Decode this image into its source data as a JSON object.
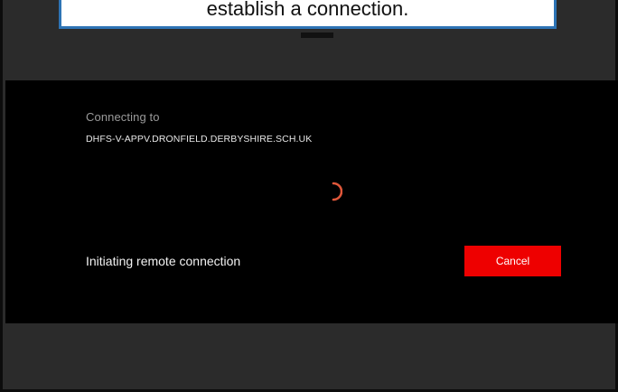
{
  "callout": {
    "text": "establish a connection."
  },
  "dialog": {
    "connecting_label": "Connecting to",
    "host": "DHFS-V-APPV.DRONFIELD.DERBYSHIRE.SCH.UK",
    "status": "Initiating remote connection",
    "cancel_label": "Cancel"
  },
  "icons": {
    "spinner": "loading-spinner-icon"
  },
  "colors": {
    "accent": "#ee0000",
    "spinner": "#e0573a",
    "callout_border": "#2e74b5",
    "dialog_bg": "#000000",
    "app_bg": "#2b2b2b"
  }
}
